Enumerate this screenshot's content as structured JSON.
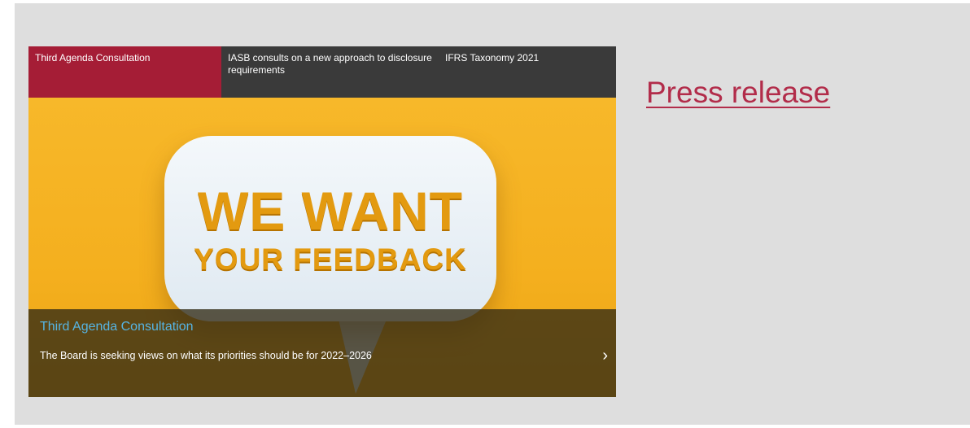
{
  "carousel": {
    "tabs": [
      {
        "label": "Third Agenda Consultation"
      },
      {
        "label": "IASB consults on a new approach to disclosure requirements"
      },
      {
        "label": "IFRS Taxonomy 2021"
      }
    ],
    "hero": {
      "headline_line1": "WE WANT",
      "headline_line2": "YOUR FEEDBACK"
    },
    "caption": {
      "title": "Third Agenda Consultation",
      "text": "The Board is seeking views on what its priorities should be for 2022–2026"
    },
    "next_icon": "›"
  },
  "press_release": {
    "label": "Press release"
  },
  "colors": {
    "accent_red": "#a51d36",
    "tab_bar": "#3a3a3a",
    "hero_yellow": "#f5b321",
    "caption_title_blue": "#56b4e3",
    "link_red": "#b22c4a"
  }
}
